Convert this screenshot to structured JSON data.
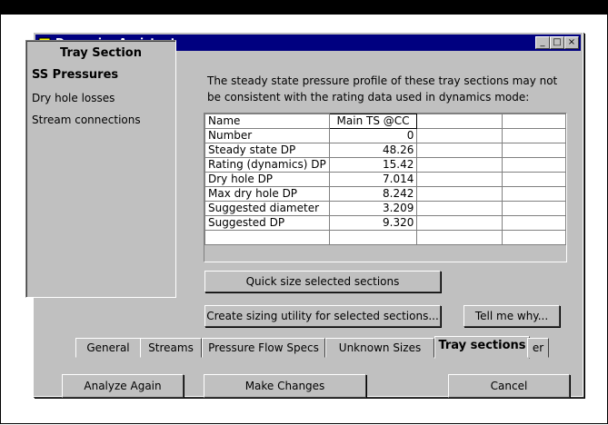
{
  "window": {
    "title": "Dynamics Assistant",
    "min_label": "_",
    "max_label": "□",
    "close_label": "×"
  },
  "left_panel": {
    "heading": "Tray Section",
    "items": [
      {
        "label": "SS Pressures",
        "selected": true
      },
      {
        "label": "Dry hole losses",
        "selected": false
      },
      {
        "label": "Stream connections",
        "selected": false
      }
    ]
  },
  "description": "The steady state pressure profile of these tray sections may not be consistent with the rating data used in dynamics mode:",
  "table": {
    "header": {
      "label": "Name",
      "value": "Main TS @CC"
    },
    "rows": [
      {
        "label": "Number",
        "value": "0"
      },
      {
        "label": "Steady state DP",
        "value": "48.26"
      },
      {
        "label": "Rating (dynamics) DP",
        "value": "15.42"
      },
      {
        "label": "Dry hole DP",
        "value": "7.014"
      },
      {
        "label": "Max dry hole DP",
        "value": "8.242"
      },
      {
        "label": "Suggested diameter",
        "value": "3.209"
      },
      {
        "label": "Suggested DP",
        "value": "9.320"
      },
      {
        "label": "",
        "value": ""
      }
    ]
  },
  "buttons": {
    "quick_size": "Quick size selected sections",
    "create_utility": "Create sizing utility for selected sections...",
    "tell_me_why": "Tell me why...",
    "analyze_again": "Analyze Again",
    "make_changes": "Make Changes",
    "cancel": "Cancel"
  },
  "tabs": {
    "general": "General",
    "streams": "Streams",
    "pressure_flow": "Pressure Flow Specs",
    "unknown_sizes": "Unknown Sizes",
    "tray_sections": "Tray sections",
    "partial": "er"
  }
}
